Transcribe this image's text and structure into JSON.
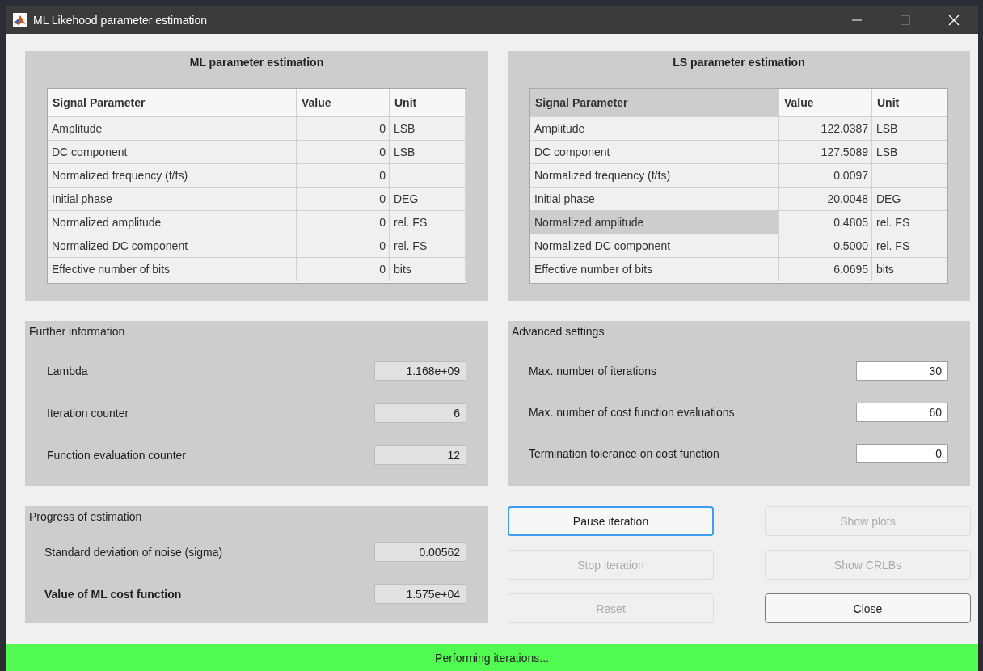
{
  "window": {
    "title": "ML Likehood parameter estimation",
    "controls": [
      {
        "kind": "minimize",
        "disabled": false
      },
      {
        "kind": "maximize",
        "disabled": true
      },
      {
        "kind": "close",
        "disabled": false
      }
    ]
  },
  "estimation_panels": [
    {
      "title": "ML parameter estimation",
      "columns": [
        {
          "label": "Signal Parameter",
          "selected": false
        },
        {
          "label": "Value",
          "selected": false
        },
        {
          "label": "Unit",
          "selected": false
        }
      ],
      "rows": [
        {
          "parameter": "Amplitude",
          "value": "0",
          "unit": "LSB",
          "selected": false
        },
        {
          "parameter": "DC component",
          "value": "0",
          "unit": "LSB",
          "selected": false
        },
        {
          "parameter": "Normalized frequency (f/fs)",
          "value": "0",
          "selected": false
        },
        {
          "parameter": "Initial phase",
          "value": "0",
          "unit": "DEG",
          "selected": false
        },
        {
          "parameter": "Normalized amplitude",
          "value": "0",
          "unit": "rel. FS",
          "selected": false
        },
        {
          "parameter": "Normalized DC component",
          "value": "0",
          "unit": "rel. FS",
          "selected": false
        },
        {
          "parameter": "Effective number of bits",
          "value": "0",
          "unit": "bits",
          "selected": false
        }
      ]
    },
    {
      "title": "LS parameter estimation",
      "columns": [
        {
          "label": "Signal Parameter",
          "selected": true
        },
        {
          "label": "Value",
          "selected": false
        },
        {
          "label": "Unit",
          "selected": false
        }
      ],
      "rows": [
        {
          "parameter": "Amplitude",
          "value": "122.0387",
          "unit": "LSB",
          "selected": false
        },
        {
          "parameter": "DC component",
          "value": "127.5089",
          "unit": "LSB",
          "selected": false
        },
        {
          "parameter": "Normalized frequency (f/fs)",
          "value": "0.0097",
          "selected": false
        },
        {
          "parameter": "Initial phase",
          "value": "20.0048",
          "unit": "DEG",
          "selected": false
        },
        {
          "parameter": "Normalized amplitude",
          "value": "0.4805",
          "unit": "rel. FS",
          "selected": true
        },
        {
          "parameter": "Normalized DC component",
          "value": "0.5000",
          "unit": "rel. FS",
          "selected": false
        },
        {
          "parameter": "Effective number of bits",
          "value": "6.0695",
          "unit": "bits",
          "selected": false
        }
      ]
    }
  ],
  "further_information": {
    "title": "Further information",
    "fields": [
      {
        "label": "Lambda",
        "value": "1.168e+09",
        "editable": false,
        "bold": false
      },
      {
        "label": "Iteration counter",
        "value": "6",
        "editable": false,
        "bold": false
      },
      {
        "label": "Function evaluation counter",
        "value": "12",
        "editable": false,
        "bold": false
      }
    ]
  },
  "advanced_settings": {
    "title": "Advanced settings",
    "fields": [
      {
        "label": "Max. number of iterations",
        "value": "30",
        "editable": true,
        "bold": false
      },
      {
        "label": "Max. number of cost function evaluations",
        "value": "60",
        "editable": true,
        "bold": false
      },
      {
        "label": "Termination tolerance on cost function",
        "value": "0",
        "editable": true,
        "bold": false
      }
    ]
  },
  "progress": {
    "title": "Progress of estimation",
    "fields": [
      {
        "label": "Standard deviation of noise (sigma)",
        "value": "0.00562",
        "editable": false,
        "bold": false
      },
      {
        "label": "Value of ML cost function",
        "value": "1.575e+04",
        "editable": false,
        "bold": true
      }
    ]
  },
  "buttons": [
    {
      "label": "Pause iteration",
      "disabled": false,
      "focused": true
    },
    {
      "label": "Show plots",
      "disabled": true,
      "focused": false
    },
    {
      "label": "Stop iteration",
      "disabled": true,
      "focused": false
    },
    {
      "label": "Show CRLBs",
      "disabled": true,
      "focused": false
    },
    {
      "label": "Reset",
      "disabled": true,
      "focused": false
    },
    {
      "label": "Close",
      "disabled": false,
      "focused": false
    }
  ],
  "status_bar": {
    "text": "Performing iterations...",
    "color": "#52fb52"
  }
}
